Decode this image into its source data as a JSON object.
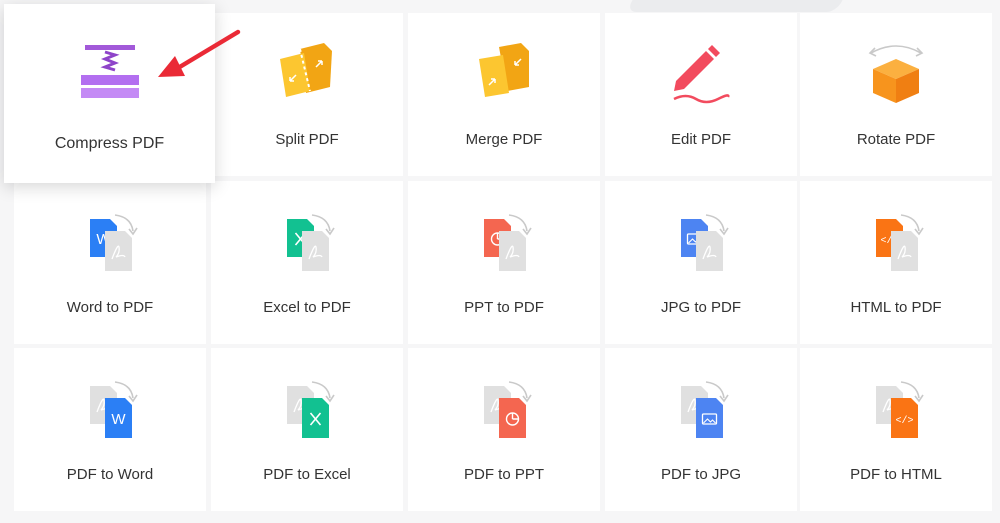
{
  "tools": [
    {
      "label": "Compress PDF",
      "icon": "compress-icon"
    },
    {
      "label": "Split PDF",
      "icon": "split-icon"
    },
    {
      "label": "Merge PDF",
      "icon": "merge-icon"
    },
    {
      "label": "Edit PDF",
      "icon": "edit-icon"
    },
    {
      "label": "Rotate PDF",
      "icon": "rotate-icon"
    },
    {
      "label": "Word to PDF",
      "icon": "word-to-pdf-icon",
      "glyph": "W",
      "color": "#2b7ff5"
    },
    {
      "label": "Excel to PDF",
      "icon": "excel-to-pdf-icon",
      "glyph": "X",
      "color": "#12c191"
    },
    {
      "label": "PPT to PDF",
      "icon": "ppt-to-pdf-icon",
      "glyph": "pie",
      "color": "#f46650"
    },
    {
      "label": "JPG to PDF",
      "icon": "jpg-to-pdf-icon",
      "glyph": "img",
      "color": "#4d84f2"
    },
    {
      "label": "HTML to PDF",
      "icon": "html-to-pdf-icon",
      "glyph": "</>",
      "color": "#fa7414"
    },
    {
      "label": "PDF to Word",
      "icon": "pdf-to-word-icon",
      "glyph": "W",
      "color": "#2b7ff5"
    },
    {
      "label": "PDF to Excel",
      "icon": "pdf-to-excel-icon",
      "glyph": "X",
      "color": "#12c191"
    },
    {
      "label": "PDF to PPT",
      "icon": "pdf-to-ppt-icon",
      "glyph": "pie",
      "color": "#f46650"
    },
    {
      "label": "PDF to JPG",
      "icon": "pdf-to-jpg-icon",
      "glyph": "img",
      "color": "#4d84f2"
    },
    {
      "label": "PDF to HTML",
      "icon": "pdf-to-html-icon",
      "glyph": "</>",
      "color": "#fa7414"
    }
  ],
  "highlight_arrow_color": "#ea2a36"
}
